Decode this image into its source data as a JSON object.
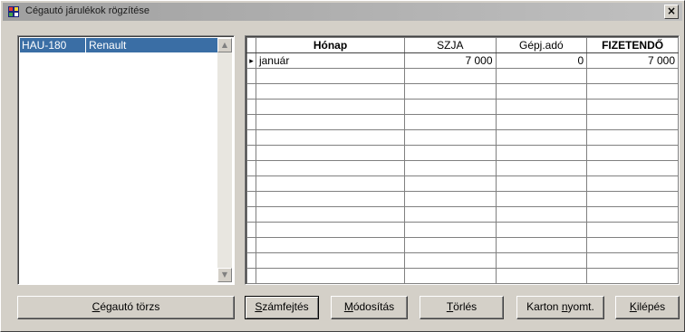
{
  "window": {
    "title": "Cégautó járulékok rögzítése",
    "close_glyph": "×"
  },
  "icons": {
    "app": "app-icon",
    "close": "close-icon",
    "scroll_up": "up-arrow-icon",
    "scroll_down": "down-arrow-icon",
    "row_pointer": "row-pointer-icon"
  },
  "list": {
    "rows": [
      {
        "plate": "HAU-180",
        "make": "Renault"
      }
    ]
  },
  "grid": {
    "headers": [
      "Hónap",
      "SZJA",
      "Gépj.adó",
      "FIZETENDŐ"
    ],
    "rows": [
      {
        "pointer": "▸",
        "honap": "január",
        "szja": "7 000",
        "gepjado": "0",
        "fizetendo": "7 000"
      }
    ]
  },
  "buttons": {
    "cegauto_torzs": {
      "mnemonic": "C",
      "rest": "égautó törzs"
    },
    "szamfejtes": {
      "mnemonic": "S",
      "rest": "zámfejtés"
    },
    "modositas": {
      "mnemonic": "M",
      "rest": "ódosítás"
    },
    "torles": {
      "mnemonic": "T",
      "rest": "örlés"
    },
    "karton": {
      "pre": "Karton ",
      "mnemonic": "n",
      "rest": "yomt."
    },
    "kilepes": {
      "mnemonic": "K",
      "rest": "ilépés"
    }
  },
  "colors": {
    "selection": "#3a6ea5",
    "face": "#d4d0c8"
  }
}
